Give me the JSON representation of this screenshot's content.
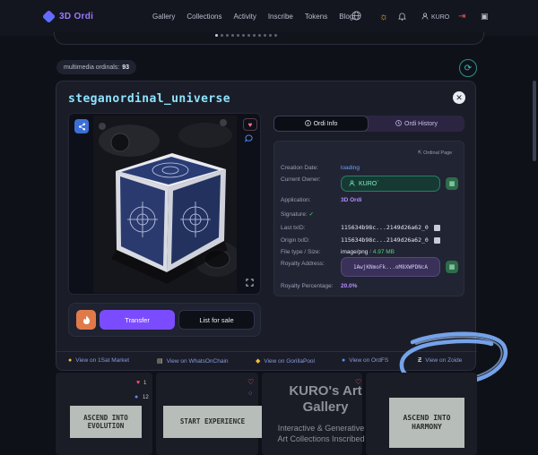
{
  "nav": {
    "brand": "3D Ordi",
    "links": [
      "Gallery",
      "Collections",
      "Activity",
      "Inscribe",
      "Tokens",
      "Blog"
    ],
    "user": "KURO"
  },
  "filter_chip": {
    "label": "multimedia ordinals:",
    "count": "93"
  },
  "modal": {
    "title": "steganordinal_universe",
    "tabs": {
      "info": "Ordi Info",
      "history": "Ordi History"
    },
    "ordi_page": "Ordinal Page",
    "rows": {
      "creation_date_label": "Creation Date:",
      "creation_date_value": "loading",
      "current_owner_label": "Current Owner:",
      "current_owner_value": "KURO`",
      "application_label": "Application:",
      "application_value": "3D Ordi",
      "signature_label": "Signature:",
      "signature_value": "✓",
      "last_txid_label": "Last txID:",
      "last_txid_value": "115634b98c...2149d26a62_0",
      "origin_txid_label": "Origin txID:",
      "origin_txid_value": "115634b98c...2149d26a62_0",
      "file_type_label": "File type / Size:",
      "file_type_value": "image/png",
      "file_size_value": "4.97 MB",
      "royalty_address_label": "Royalty Address:",
      "royalty_address_value": "1AwjKNmoFk...oM8XWPDNcA",
      "royalty_percentage_label": "Royalty Percentage:",
      "royalty_percentage_value": "20.0%"
    },
    "actions": {
      "transfer": "Transfer",
      "list_for_sale": "List for sale"
    },
    "external_links": [
      "View on 1Sat Market",
      "View on WhatsOnChain",
      "View on GorillaPool",
      "View on OrdFS",
      "View on Zoide"
    ]
  },
  "cards": [
    {
      "title": "ASCEND INTO EVOLUTION",
      "likes": "1",
      "comments": "12"
    },
    {
      "title": "START EXPERIENCE"
    },
    {
      "title": "KURO's Art Gallery",
      "subtitle": "Interactive & Generative Art Collections Inscribed"
    },
    {
      "title": "ASCEND INTO HARMONY"
    }
  ],
  "colors": {
    "accent_purple": "#7b4cff",
    "title_cyan": "#8ee3ff",
    "annotation_blue": "#7fb2ff"
  }
}
